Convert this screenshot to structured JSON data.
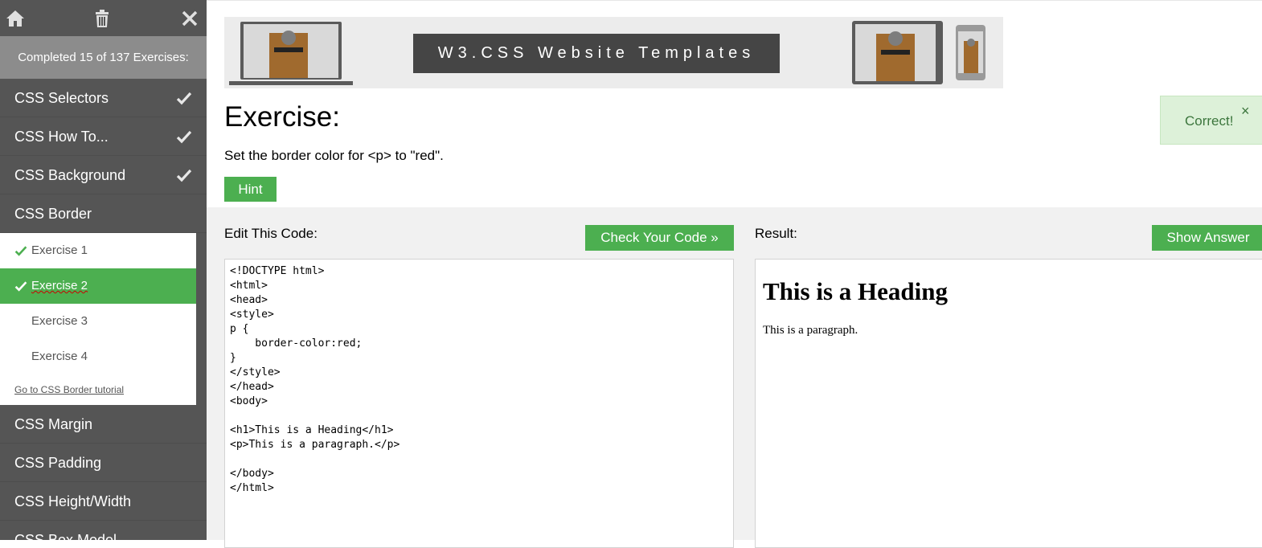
{
  "sidebar": {
    "progress_text": "Completed 15 of 137 Exercises:",
    "topics_before": [
      {
        "label": "CSS Selectors",
        "done": true
      },
      {
        "label": "CSS How To...",
        "done": true
      },
      {
        "label": "CSS Background",
        "done": true
      }
    ],
    "active_topic": "CSS Border",
    "exercises": [
      {
        "label": "Exercise 1",
        "done": true,
        "selected": false
      },
      {
        "label": "Exercise 2",
        "done": true,
        "selected": true
      },
      {
        "label": "Exercise 3",
        "done": false,
        "selected": false
      },
      {
        "label": "Exercise 4",
        "done": false,
        "selected": false
      }
    ],
    "tutorial_link": "Go to CSS Border tutorial",
    "topics_after": [
      {
        "label": "CSS Margin"
      },
      {
        "label": "CSS Padding"
      },
      {
        "label": "CSS Height/Width"
      },
      {
        "label": "CSS Box Model"
      }
    ]
  },
  "banner": {
    "title": "W3.CSS Website Templates"
  },
  "exercise": {
    "title": "Exercise:",
    "description": "Set the border color for <p> to \"red\".",
    "hint_label": "Hint"
  },
  "toast": {
    "message": "Correct!",
    "close": "×"
  },
  "editor": {
    "label": "Edit This Code:",
    "check_label": "Check Your Code »",
    "code_lines": [
      "<!DOCTYPE html>",
      "<html>",
      "<head>",
      "<style>",
      "p {",
      "    border-color:red;",
      "}",
      "</style>",
      "</head>",
      "<body>",
      "",
      "<h1>This is a Heading</h1>",
      "<p>This is a paragraph.</p>",
      "",
      "</body>",
      "</html>"
    ]
  },
  "result": {
    "label": "Result:",
    "show_answer_label": "Show Answer",
    "heading": "This is a Heading",
    "paragraph": "This is a paragraph."
  },
  "colors": {
    "sidebar_bg": "#555555",
    "progress_bg": "#8c8c8c",
    "accent_green": "#4caf50",
    "toast_bg": "#ddf1d9",
    "work_bg": "#f1f1f1"
  },
  "icons": {
    "home": "home-icon",
    "trash": "trash-icon",
    "close": "close-icon",
    "check": "check-icon"
  }
}
